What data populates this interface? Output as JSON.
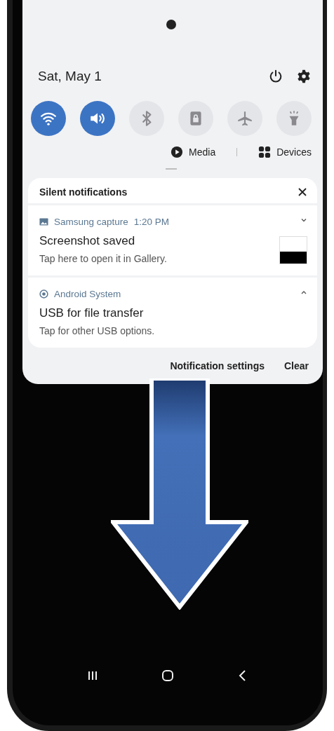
{
  "quick_panel": {
    "date": "Sat, May 1",
    "toggles": [
      {
        "on": true
      },
      {
        "on": true
      },
      {
        "on": false
      },
      {
        "on": false
      },
      {
        "on": false
      },
      {
        "on": false
      }
    ],
    "media_label": "Media",
    "devices_label": "Devices"
  },
  "notifications": {
    "header": "Silent notifications",
    "items": [
      {
        "kind": "image",
        "app": "Samsung capture",
        "time": "1:20 PM",
        "title": "Screenshot saved",
        "body": "Tap here to open it in Gallery.",
        "expanded": false
      },
      {
        "kind": "system",
        "app": "Android System",
        "title": "USB for file transfer",
        "body": "Tap for other USB options.",
        "expanded": true
      }
    ],
    "buttons": [
      "Notification settings",
      "Clear"
    ]
  }
}
